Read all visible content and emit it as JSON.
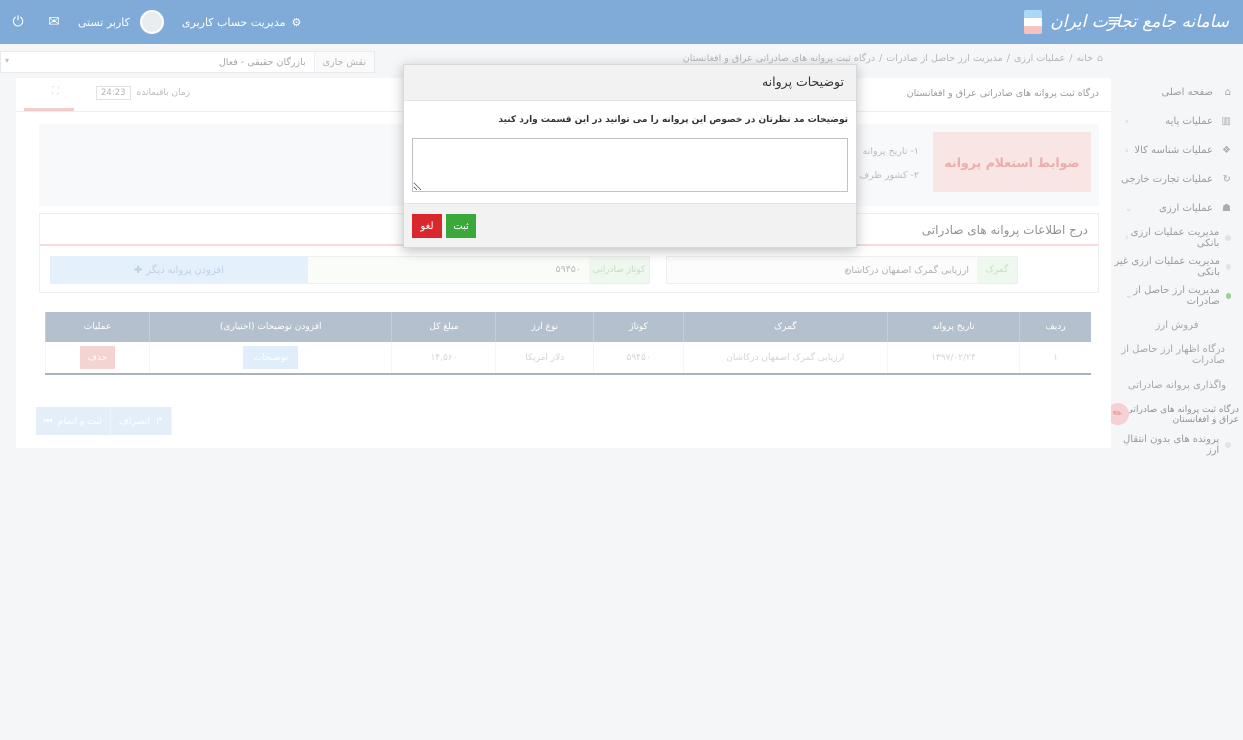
{
  "app": {
    "brand_title": "سامانه جامع تجارت ایران",
    "account_management": "مدیریت حساب کاربری",
    "user_name": "کاربر تستی"
  },
  "sidebar": {
    "items": [
      {
        "label": "صفحه اصلی",
        "icon": "home-icon"
      },
      {
        "label": "عملیات پایه",
        "icon": "chart-icon"
      },
      {
        "label": "عملیات شناسه کالا",
        "icon": "cubes-icon"
      },
      {
        "label": "عملیات تجارت خارجی",
        "icon": "refresh-icon"
      },
      {
        "label": "عملیات ارزی",
        "icon": "users-icon"
      }
    ],
    "sub_items": [
      {
        "label": "مدیریت عملیات ارزی بانکی"
      },
      {
        "label": "مدیریت عملیات ارزی غیر بانکی"
      },
      {
        "label": "مدیریت ارز حاصل از صادرات"
      }
    ],
    "leaf_items": [
      {
        "label": "فروش ارز"
      },
      {
        "label": "درگاه اظهار ارز حاصل از صادرات"
      },
      {
        "label": "واگذاری پروانه صادراتی"
      },
      {
        "label": "درگاه ثبت پروانه های صادراتی عراق و افغانستان"
      }
    ],
    "last_item": "پرونده های بدون انتقال ارز"
  },
  "breadcrumb": {
    "items": [
      "خانه",
      "عملیات ارزی",
      "مدیریت ارز حاصل از صادرات",
      "درگاه ثبت پروانه های صادراتی عراق و افغانستان"
    ]
  },
  "role": {
    "label": "نقش جاری",
    "value": "بازرگان حقیقی - فعال"
  },
  "main": {
    "title": "درگاه ثبت پروانه های صادراتی عراق و افغانستان",
    "timer_label": "زمان باقیمانده",
    "timer_value": "24:23"
  },
  "info": {
    "rules_title": "ضوابط استعلام پروانه",
    "line1": "۱- تاریخ پروانه",
    "line2": "۲- کشور طرف"
  },
  "form": {
    "title": "درج اطلاعات پروانه های صادراتی",
    "customs_label": "گمرک",
    "customs_value": "ارزیابی گمرک اصفهان دركاشان",
    "code_label": "کوتاژ صادراتی",
    "code_value": "۵۹۴۵۰",
    "add_button": "افزودن پروانه دیگر"
  },
  "table": {
    "headers": [
      "ردیف",
      "تاریخ پروانه",
      "گمرک",
      "کوتاژ",
      "نوع ارز",
      "مبلغ کل",
      "افزودن توضیحات (اختیاری)",
      "عملیات"
    ],
    "rows": [
      {
        "index": "۱",
        "date": "۱۳۹۷/۰۲/۲۴",
        "customs": "ارزیابی گمرک اصفهان دركاشان",
        "code": "۵۹۴۵۰",
        "currency": "دلار امریکا",
        "amount": "۱۴,۵۶۰",
        "desc_button": "توضیحات",
        "delete_button": "حذف"
      }
    ]
  },
  "bottom": {
    "cancel_label": "انصراف",
    "submit_label": "ثبت و اتمام"
  },
  "modal": {
    "title": "توضیحات پروانه",
    "hint": "توضیحات مد نظرتان در خصوص این پروانه را می توانید در این قسمت وارد کنید",
    "textarea_value": "",
    "submit": "ثبت",
    "cancel": "لغو"
  }
}
